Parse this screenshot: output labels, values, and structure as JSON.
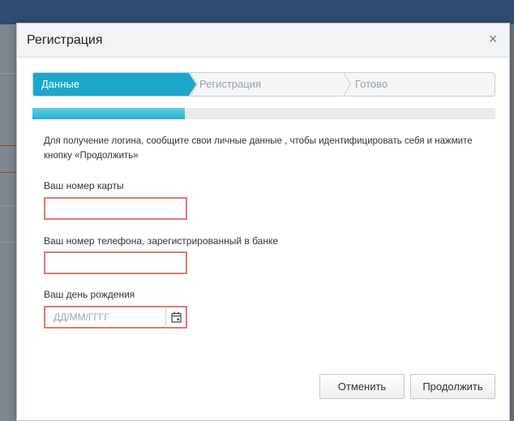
{
  "dialog": {
    "title": "Регистрация",
    "close_symbol": "×"
  },
  "wizard": {
    "steps": [
      {
        "label": "Данные",
        "active": true
      },
      {
        "label": "Регистрация",
        "active": false
      },
      {
        "label": "Готово",
        "active": false
      }
    ]
  },
  "progress": {
    "percent": 33
  },
  "form": {
    "intro": "Для получение логина, сообщите свои личные данные , чтобы идентифицировать себя и нажмите кнопку «Продолжить»",
    "card_label": "Ваш номер карты",
    "card_value": "",
    "phone_label": "Ваш номер телефона, зарегистрированный в банке",
    "phone_value": "",
    "birthday_label": "Ваш день рождения",
    "birthday_placeholder": "ДД/ММ/ГГГГ",
    "birthday_icon": "calendar-icon"
  },
  "buttons": {
    "cancel": "Отменить",
    "continue": "Продолжить"
  },
  "colors": {
    "accent": "#1ba8cb",
    "error_border": "#e57575",
    "progress_fill": "#3cb9da"
  }
}
